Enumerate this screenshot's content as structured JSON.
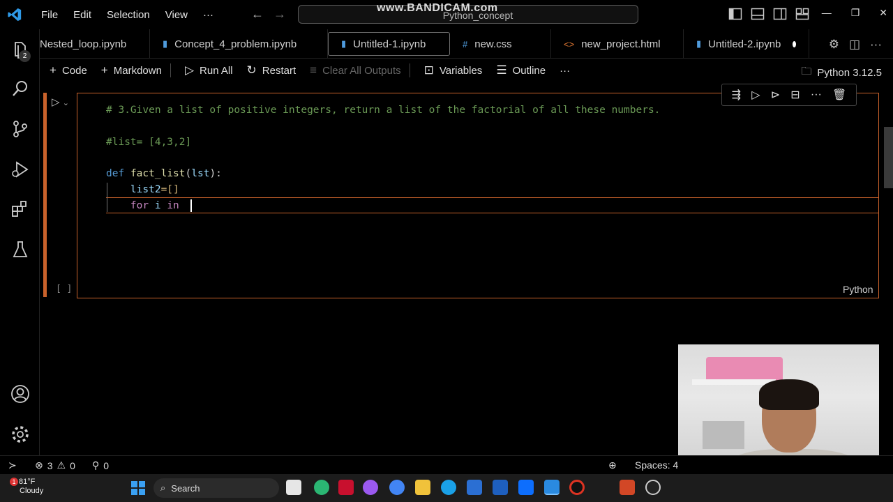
{
  "titlebar": {
    "menu": [
      "File",
      "Edit",
      "Selection",
      "View",
      "···"
    ],
    "command_center": "Python_concept",
    "watermark": "www.BANDICAM.com"
  },
  "activity": {
    "source_control_badge": "2"
  },
  "tabs": [
    {
      "label": "Nested_loop.ipynb",
      "icon": "notebook-icon"
    },
    {
      "label": "Concept_4_problem.ipynb",
      "icon": "notebook-icon"
    },
    {
      "label": "Untitled-1.ipynb",
      "icon": "notebook-icon",
      "active": true,
      "dirty": true
    },
    {
      "label": "new.css",
      "icon": "css-icon"
    },
    {
      "label": "new_project.html",
      "icon": "html-icon"
    },
    {
      "label": "Untitled-2.ipynb",
      "icon": "notebook-icon",
      "dirty": true
    }
  ],
  "toolbar": {
    "code": "Code",
    "markdown": "Markdown",
    "run_all": "Run All",
    "restart": "Restart",
    "clear_outputs": "Clear All Outputs",
    "variables": "Variables",
    "outline": "Outline",
    "more": "···",
    "kernel": "Python 3.12.5"
  },
  "cell": {
    "exec_count": "[ ]",
    "language": "Python",
    "lines": {
      "l1": "# 3.Given a list of positive integers, return a list of the factorial of all these numbers.",
      "l2": "#list= [4,3,2]",
      "l3_kw": "def",
      "l3_fn": "fact_list",
      "l3_p": "lst",
      "l4_var": "list2",
      "l4_rest": "=[]",
      "l5_for": "for",
      "l5_i": "i",
      "l5_in": "in"
    }
  },
  "statusbar": {
    "errors": "3",
    "warnings": "0",
    "ports": "0",
    "spaces": "Spaces: 4"
  },
  "taskbar": {
    "temp": "81°F",
    "weather": "Cloudy",
    "weather_badge": "1",
    "search": "Search"
  },
  "colors": {
    "accent_cell": "#c9622b",
    "comment": "#6a9955",
    "keyword": "#569cd6",
    "function": "#dcdcaa",
    "param": "#9cdcfe"
  }
}
